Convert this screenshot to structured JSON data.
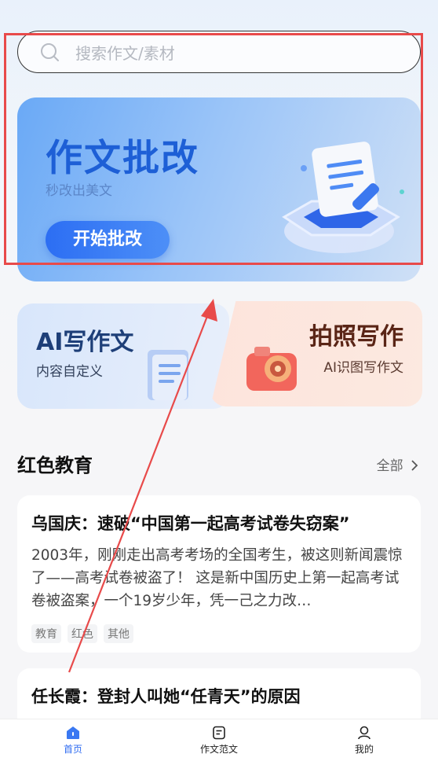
{
  "search": {
    "placeholder": "搜索作文/素材"
  },
  "banner": {
    "title": "作文批改",
    "subtitle": "秒改出美文",
    "button": "开始批改"
  },
  "cards": {
    "ai": {
      "title": "AI写作文",
      "subtitle": "内容自定义"
    },
    "photo": {
      "title": "拍照写作",
      "subtitle": "AI识图写作文"
    }
  },
  "section": {
    "title": "红色教育",
    "all": "全部"
  },
  "articles": [
    {
      "title": "乌国庆：速破“中国第一起高考试卷失窃案”",
      "summary": "2003年，刚刚走出高考考场的全国考生，被这则新闻震惊了——高考试卷被盗了！ 这是新中国历史上第一起高考试卷被盗案，一个19岁少年，凭一己之力改…",
      "tags": [
        "教育",
        "红色",
        "其他"
      ]
    },
    {
      "title": "任长霞：登封人叫她“任青天”的原因"
    }
  ],
  "tabbar": [
    {
      "label": "首页",
      "icon": "home-icon",
      "active": true
    },
    {
      "label": "作文范文",
      "icon": "document-icon",
      "active": false
    },
    {
      "label": "我的",
      "icon": "user-icon",
      "active": false
    }
  ],
  "colors": {
    "accent": "#2f6cf1",
    "annotation": "#e84a4a"
  }
}
